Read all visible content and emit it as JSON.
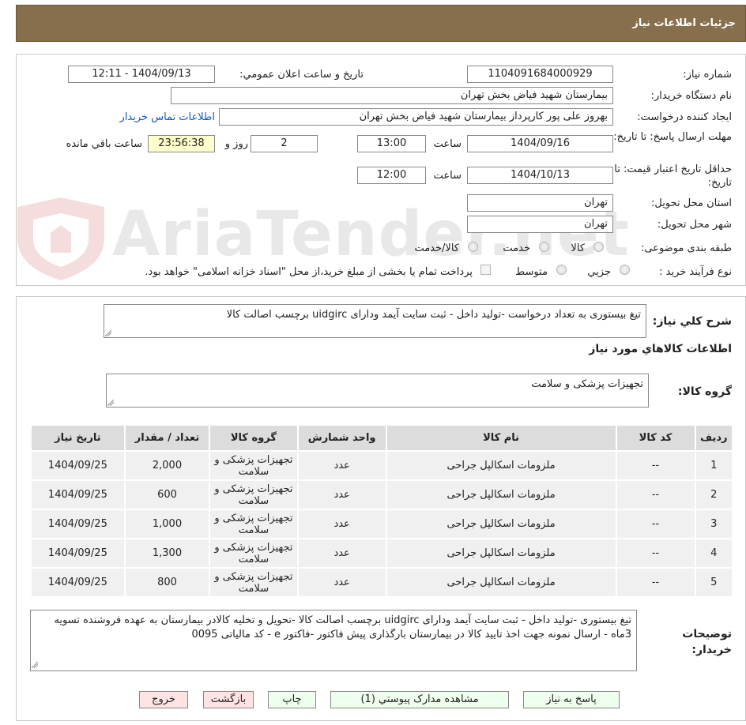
{
  "page": {
    "title": "جزئیات اطلاعات نیاز"
  },
  "form": {
    "need_number": {
      "label": "شماره نیاز:",
      "value": "1104091684000929"
    },
    "announce": {
      "label": "تاریخ و ساعت اعلان عمومي:",
      "value": "1404/09/13 - 12:11"
    },
    "buyer_org": {
      "label": "نام دستگاه خریدار:",
      "value": "بیمارستان شهید فیاض بخش تهران"
    },
    "requester": {
      "label": "ایجاد کننده درخواست:",
      "value": "بهروز علی پور کارپرداز بیمارستان شهید فیاض بخش تهران",
      "contact_link": "اطلاعات تماس خریدار"
    },
    "reply_deadline": {
      "label": "مهلت ارسال پاسخ: تا تاریخ:",
      "date": "1404/09/16",
      "time_label": "ساعت",
      "time": "13:00",
      "days": "2",
      "days_label": "روز و",
      "remaining": "23:56:38",
      "remaining_label": "ساعت باقي مانده"
    },
    "price_validity": {
      "label": "حداقل تاریخ اعتبار قیمت: تا تاریخ:",
      "date": "1404/10/13",
      "time_label": "ساعت",
      "time": "12:00"
    },
    "province": {
      "label": "استان محل تحویل:",
      "value": "تهران"
    },
    "city": {
      "label": "شهر محل تحویل:",
      "value": "تهران"
    },
    "category": {
      "label": "طبقه بندی موضوعی:",
      "options": [
        "کالا",
        "خدمت",
        "کالا/خدمت"
      ]
    },
    "purchase_type": {
      "label": "نوع فرآیند خرید :",
      "options": [
        "جزیي",
        "متوسط"
      ],
      "note": "پرداخت تمام یا بخشی از مبلغ خرید،از محل \"اسناد خزانه اسلامی\" خواهد بود."
    }
  },
  "summary": {
    "label": "شرح کلي نیاز:",
    "value": "تیغ بیستوری به تعداد درخواست  -تولید داخل - ثبت سایت آیمد ودارای uidgirc برچسب اصالت کالا",
    "goods_section_title": "اطلاعات کالاهاي مورد نیاز",
    "group_label": "گروه کالا:",
    "group_value": "تجهیزات پزشکی و سلامت"
  },
  "table": {
    "headers": [
      "ردیف",
      "کد کالا",
      "نام کالا",
      "واحد شمارش",
      "گروه کالا",
      "تعداد / مقدار",
      "تاریخ نیاز"
    ],
    "rows": [
      {
        "row": "1",
        "code": "--",
        "name": "ملزومات اسکالپل جراحی",
        "unit": "عدد",
        "group": "تجهیزات پزشکی و سلامت",
        "qty": "2,000",
        "date": "1404/09/25"
      },
      {
        "row": "2",
        "code": "--",
        "name": "ملزومات اسکالپل جراحی",
        "unit": "عدد",
        "group": "تجهیزات پزشکی و سلامت",
        "qty": "600",
        "date": "1404/09/25"
      },
      {
        "row": "3",
        "code": "--",
        "name": "ملزومات اسکالپل جراحی",
        "unit": "عدد",
        "group": "تجهیزات پزشکی و سلامت",
        "qty": "1,000",
        "date": "1404/09/25"
      },
      {
        "row": "4",
        "code": "--",
        "name": "ملزومات اسکالپل جراحی",
        "unit": "عدد",
        "group": "تجهیزات پزشکی و سلامت",
        "qty": "1,300",
        "date": "1404/09/25"
      },
      {
        "row": "5",
        "code": "--",
        "name": "ملزومات اسکالپل جراحی",
        "unit": "عدد",
        "group": "تجهیزات پزشکی و سلامت",
        "qty": "800",
        "date": "1404/09/25"
      }
    ]
  },
  "buyer_notes": {
    "label": "توضیحات خریدار:",
    "value": "تیغ بیستوری  -تولید داخل - ثبت سایت آیمد ودارای uidgirc برچسب اصالت کالا -تحویل و تخلیه کالادر بیمارستان به عهده فروشنده  تسویه 3ماه - ارسال نمونه جهت اخذ تایید کالا در بیمارستان بارگذاری پیش فاکتور -فاکتور e - کد مالیاتی 0095"
  },
  "buttons": {
    "reply": "پاسخ به نیاز",
    "attachments": "مشاهده مدارک پیوستي (1)",
    "print": "چاپ",
    "back": "بازگشت",
    "exit": "خروج"
  },
  "watermark": {
    "text": "AriaTender.net"
  }
}
